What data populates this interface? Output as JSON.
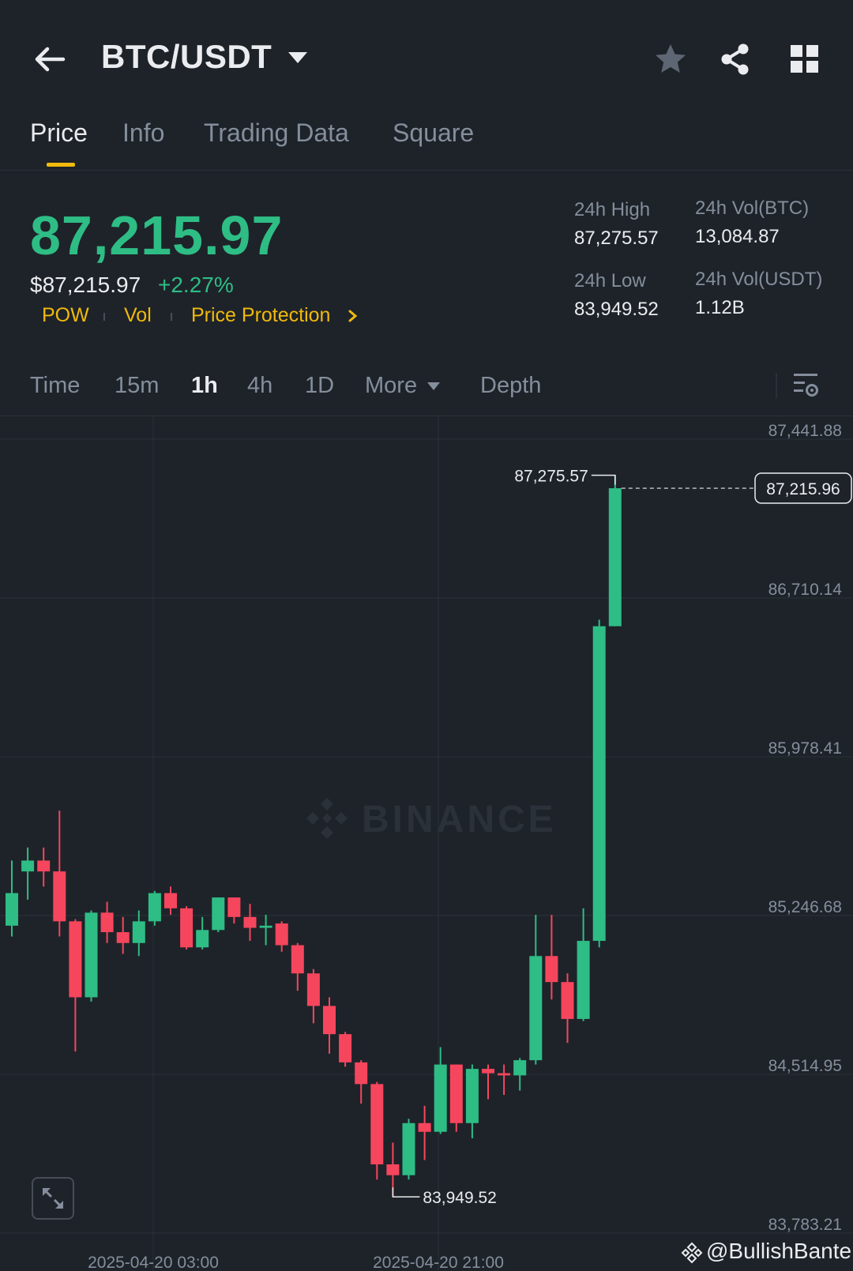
{
  "header": {
    "pair": "BTC/USDT"
  },
  "tabs": [
    {
      "label": "Price",
      "active": true
    },
    {
      "label": "Info",
      "active": false
    },
    {
      "label": "Trading Data",
      "active": false
    },
    {
      "label": "Square",
      "active": false
    }
  ],
  "price": {
    "last": "87,215.97",
    "usd": "$87,215.97",
    "change": "+2.27%",
    "tags": [
      "POW",
      "Vol",
      "Price Protection"
    ]
  },
  "stats": {
    "high_label": "24h High",
    "high_value": "87,275.57",
    "low_label": "24h Low",
    "low_value": "83,949.52",
    "vol_btc_label": "24h Vol(BTC)",
    "vol_btc_value": "13,084.87",
    "vol_usdt_label": "24h Vol(USDT)",
    "vol_usdt_value": "1.12B"
  },
  "timeframes": [
    {
      "label": "Time",
      "active": false
    },
    {
      "label": "15m",
      "active": false
    },
    {
      "label": "1h",
      "active": true
    },
    {
      "label": "4h",
      "active": false
    },
    {
      "label": "1D",
      "active": false
    },
    {
      "label": "More",
      "active": false
    },
    {
      "label": "Depth",
      "active": false
    }
  ],
  "colors": {
    "up": "#2ebd85",
    "down": "#f6465d",
    "accent": "#f0b90b",
    "background": "#1e2329"
  },
  "chart_data": {
    "type": "candlestick",
    "interval": "1h",
    "y_ticks": [
      "87,441.88",
      "86,710.14",
      "85,978.41",
      "85,246.68",
      "84,514.95",
      "83,783.21"
    ],
    "y_tick_values": [
      87441.88,
      86710.14,
      85978.41,
      85246.68,
      84514.95,
      83783.21
    ],
    "ylim": [
      83783.21,
      87441.88
    ],
    "x_ticks": [
      "2025-04-20 03:00",
      "2025-04-20 21:00"
    ],
    "current_price_label": "87,215.96",
    "max_label": "87,275.57",
    "min_label": "83,949.52",
    "watermark": "BINANCE",
    "candles": [
      {
        "o": 85200,
        "h": 85500,
        "l": 85150,
        "c": 85350
      },
      {
        "o": 85450,
        "h": 85560,
        "l": 85320,
        "c": 85500
      },
      {
        "o": 85500,
        "h": 85560,
        "l": 85380,
        "c": 85450
      },
      {
        "o": 85450,
        "h": 85730,
        "l": 85150,
        "c": 85220
      },
      {
        "o": 85220,
        "h": 85230,
        "l": 84620,
        "c": 84870
      },
      {
        "o": 84870,
        "h": 85270,
        "l": 84850,
        "c": 85260
      },
      {
        "o": 85260,
        "h": 85310,
        "l": 85120,
        "c": 85170
      },
      {
        "o": 85170,
        "h": 85240,
        "l": 85070,
        "c": 85120
      },
      {
        "o": 85120,
        "h": 85270,
        "l": 85060,
        "c": 85220
      },
      {
        "o": 85220,
        "h": 85360,
        "l": 85200,
        "c": 85350
      },
      {
        "o": 85350,
        "h": 85380,
        "l": 85250,
        "c": 85280
      },
      {
        "o": 85280,
        "h": 85290,
        "l": 85090,
        "c": 85100
      },
      {
        "o": 85100,
        "h": 85240,
        "l": 85090,
        "c": 85180
      },
      {
        "o": 85180,
        "h": 85330,
        "l": 85170,
        "c": 85330
      },
      {
        "o": 85330,
        "h": 85330,
        "l": 85210,
        "c": 85240
      },
      {
        "o": 85240,
        "h": 85300,
        "l": 85130,
        "c": 85190
      },
      {
        "o": 85190,
        "h": 85250,
        "l": 85110,
        "c": 85200
      },
      {
        "o": 85210,
        "h": 85220,
        "l": 85080,
        "c": 85110
      },
      {
        "o": 85110,
        "h": 85120,
        "l": 84900,
        "c": 84980
      },
      {
        "o": 84980,
        "h": 85000,
        "l": 84750,
        "c": 84830
      },
      {
        "o": 84830,
        "h": 84870,
        "l": 84610,
        "c": 84700
      },
      {
        "o": 84700,
        "h": 84710,
        "l": 84550,
        "c": 84570
      },
      {
        "o": 84570,
        "h": 84580,
        "l": 84380,
        "c": 84470
      },
      {
        "o": 84470,
        "h": 84480,
        "l": 84030,
        "c": 84100
      },
      {
        "o": 84100,
        "h": 84200,
        "l": 83950,
        "c": 84050
      },
      {
        "o": 84050,
        "h": 84310,
        "l": 84030,
        "c": 84290
      },
      {
        "o": 84290,
        "h": 84370,
        "l": 84120,
        "c": 84250
      },
      {
        "o": 84250,
        "h": 84640,
        "l": 84240,
        "c": 84560
      },
      {
        "o": 84560,
        "h": 84560,
        "l": 84250,
        "c": 84290
      },
      {
        "o": 84290,
        "h": 84560,
        "l": 84220,
        "c": 84540
      },
      {
        "o": 84540,
        "h": 84560,
        "l": 84400,
        "c": 84520
      },
      {
        "o": 84520,
        "h": 84560,
        "l": 84420,
        "c": 84510
      },
      {
        "o": 84510,
        "h": 84590,
        "l": 84440,
        "c": 84580
      },
      {
        "o": 84580,
        "h": 85250,
        "l": 84560,
        "c": 85060
      },
      {
        "o": 85060,
        "h": 85250,
        "l": 84860,
        "c": 84940
      },
      {
        "o": 84940,
        "h": 84980,
        "l": 84660,
        "c": 84770
      },
      {
        "o": 84770,
        "h": 85280,
        "l": 84760,
        "c": 85130
      },
      {
        "o": 85130,
        "h": 86610,
        "l": 85100,
        "c": 86580
      },
      {
        "o": 86580,
        "h": 87275.57,
        "l": 86580,
        "c": 87215.96
      }
    ]
  }
}
